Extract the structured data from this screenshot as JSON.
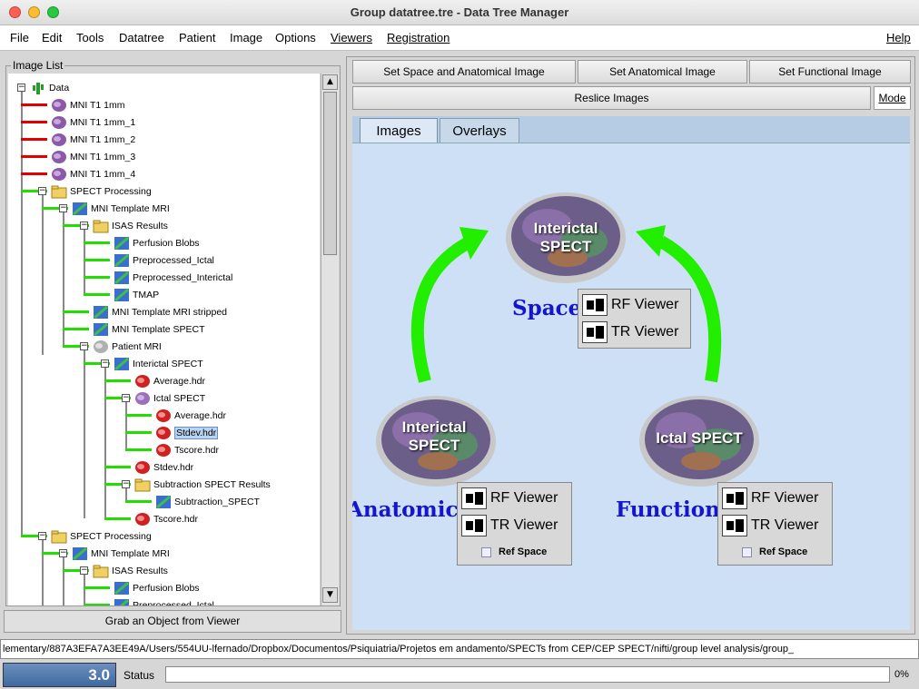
{
  "window": {
    "title": "Group datatree.tre - Data Tree Manager"
  },
  "menu": [
    "File",
    "Edit",
    "Tools",
    "Datatree",
    "Patient",
    "Image",
    "Options",
    "Viewers",
    "Registration"
  ],
  "help": "Help",
  "image_list": {
    "legend": "Image List",
    "items": [
      "Data",
      "MNI T1 1mm",
      "MNI T1 1mm_1",
      "MNI T1 1mm_2",
      "MNI T1 1mm_3",
      "MNI T1 1mm_4",
      "SPECT Processing",
      "MNI Template MRI",
      "ISAS Results",
      "Perfusion Blobs",
      "Preprocessed_Ictal",
      "Preprocessed_Interictal",
      "TMAP",
      "MNI Template MRI stripped",
      "MNI Template SPECT",
      "Patient MRI",
      "Interictal SPECT",
      "Average.hdr",
      "Ictal SPECT",
      "Average.hdr",
      "Stdev.hdr",
      "Tscore.hdr",
      "Stdev.hdr",
      "Subtraction SPECT Results",
      "Subtraction_SPECT",
      "Tscore.hdr",
      "SPECT Processing",
      "MNI Template MRI",
      "ISAS Results",
      "Perfusion Blobs",
      "Preprocessed_Ictal"
    ],
    "selected_index": 20
  },
  "grab_button": "Grab an Object from Viewer",
  "toolbar": {
    "set_space": "Set Space and Anatomical Image",
    "set_anatomical": "Set Anatomical Image",
    "set_functional": "Set Functional Image",
    "reslice": "Reslice Images",
    "mode": "Mode"
  },
  "tabs": {
    "images": "Images",
    "overlays": "Overlays"
  },
  "diagram": {
    "top_brain": {
      "line1": "Interictal",
      "line2": "SPECT"
    },
    "left_brain": {
      "line1": "Interictal",
      "line2": "SPECT"
    },
    "right_brain": {
      "line1": "Ictal SPECT"
    },
    "space_label": "Space",
    "anatomical_label": "Anatomical",
    "functional_label": "Functional",
    "rf_viewer": "RF Viewer",
    "tr_viewer": "TR Viewer",
    "ref_space": "Ref Space",
    "arrow_color": "#22ee00",
    "label_color": "#1515d0"
  },
  "path": "lementary/887A3EFA7A3EE49A/Users/554UU-lfernado/Dropbox/Documentos/Psiquiatria/Projetos em andamento/SPECTs from CEP/CEP SPECT/nifti/group level analysis/group_",
  "status": {
    "version": "3.0",
    "label": "Status",
    "percent": "0%"
  }
}
